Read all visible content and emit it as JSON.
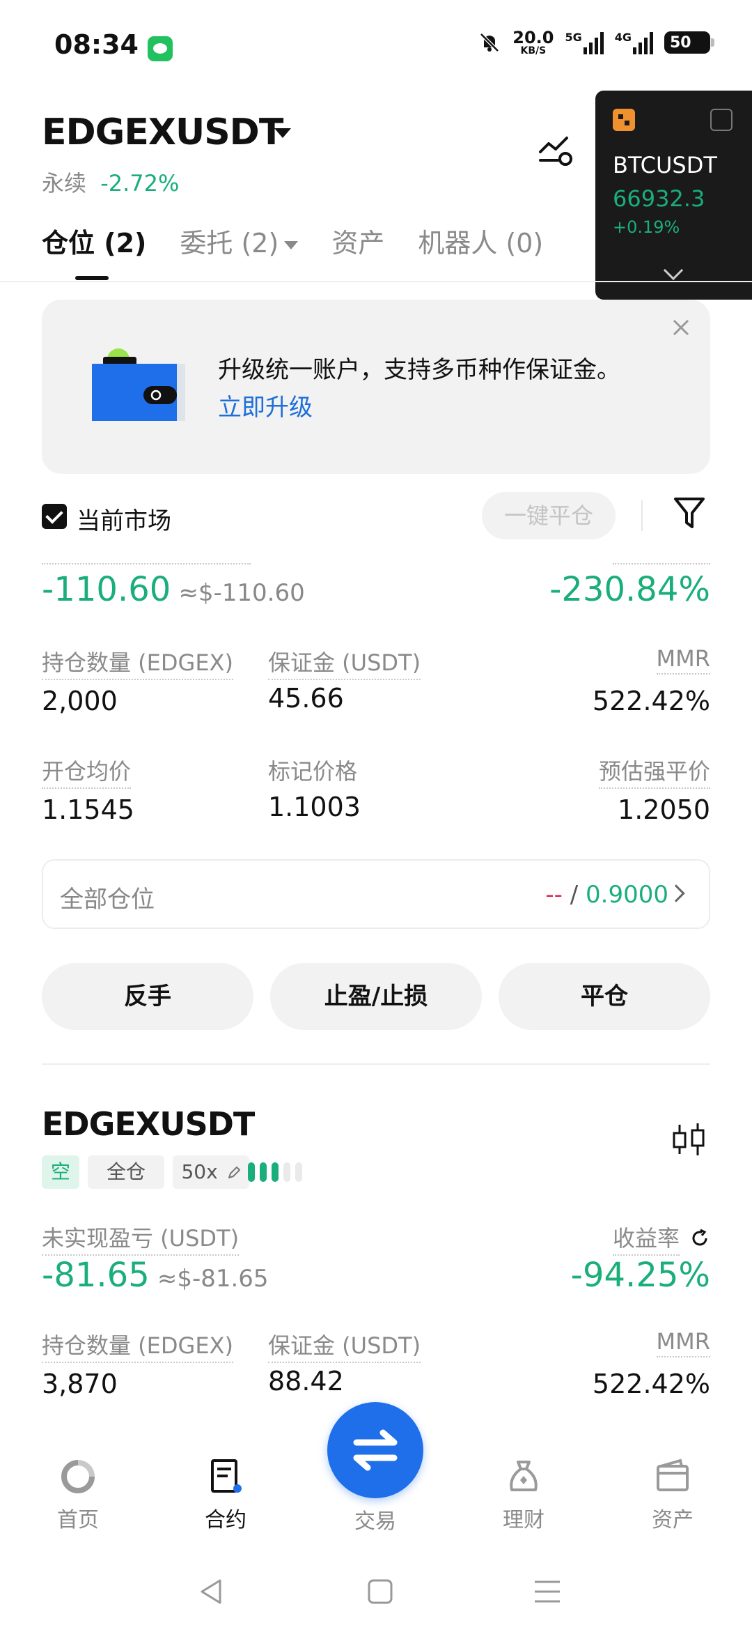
{
  "status_bar": {
    "time": "08:34",
    "net_speed_value": "20.0",
    "net_speed_unit": "KB/S",
    "sim1": "5G",
    "sim2": "4G",
    "battery": "50"
  },
  "header": {
    "symbol": "EDGEXUSDT",
    "contract_type": "永续",
    "change": "-2.72%"
  },
  "floating_ticker": {
    "symbol": "BTCUSDT",
    "price": "66932.3",
    "change": "+0.19%"
  },
  "tabs": [
    {
      "label": "仓位 (2)"
    },
    {
      "label": "委托 (2)"
    },
    {
      "label": "资产"
    },
    {
      "label": "机器人 (0)"
    }
  ],
  "banner": {
    "text": "升级统一账户，支持多币种作保证金。",
    "link": "立即升级"
  },
  "filter": {
    "current_market_label": "当前市场",
    "close_all_label": "一键平仓"
  },
  "position1": {
    "unrealized_pnl": "-110.60",
    "pnl_approx": "≈$-110.60",
    "roi": "-230.84%",
    "qty_label": "持仓数量 (EDGEX)",
    "qty": "2,000",
    "margin_label": "保证金 (USDT)",
    "margin": "45.66",
    "mmr_label": "MMR",
    "mmr": "522.42%",
    "entry_label": "开仓均价",
    "entry": "1.1545",
    "mark_label": "标记价格",
    "mark": "1.1003",
    "liq_label": "预估强平价",
    "liq": "1.2050",
    "all_positions_label": "全部仓位",
    "all_positions_dash": "--",
    "all_positions_sep": " / ",
    "all_positions_value": "0.9000",
    "btn_reverse": "反手",
    "btn_tpsl": "止盈/止损",
    "btn_close": "平仓"
  },
  "position2": {
    "symbol": "EDGEXUSDT",
    "side": "空",
    "margin_mode": "全仓",
    "leverage": "50x",
    "risk_level": 0.6,
    "pnl_label": "未实现盈亏 (USDT)",
    "unrealized_pnl": "-81.65",
    "pnl_approx": "≈$-81.65",
    "roi_label": "收益率",
    "roi": "-94.25%",
    "qty_label": "持仓数量 (EDGEX)",
    "qty": "3,870",
    "margin_label": "保证金 (USDT)",
    "margin": "88.42",
    "mmr_label": "MMR",
    "mmr": "522.42%"
  },
  "bottom_nav": {
    "home": "首页",
    "futures": "合约",
    "trade": "交易",
    "earn": "理财",
    "assets": "资产"
  },
  "colors": {
    "green": "#1aae7a",
    "red": "#e0335b",
    "orange": "#f0912f",
    "blue": "#1f6fea"
  }
}
